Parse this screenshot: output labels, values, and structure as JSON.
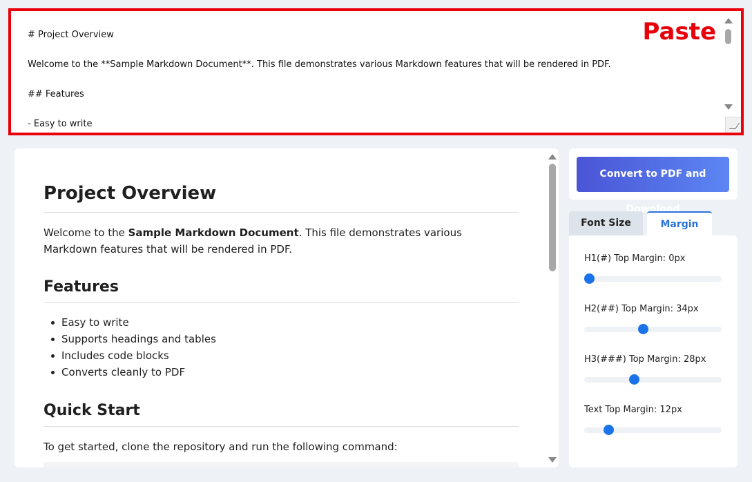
{
  "editor": {
    "lines": [
      "# Project Overview",
      "Welcome to the **Sample Markdown Document**. This file demonstrates various Markdown features that will be rendered in PDF.",
      "## Features",
      "- Easy to write"
    ],
    "annotation": "Paste"
  },
  "preview": {
    "h1": "Project Overview",
    "intro_before": "Welcome to the ",
    "intro_bold": "Sample Markdown Document",
    "intro_after": ". This file demonstrates various Markdown features that will be rendered in PDF.",
    "features_heading": "Features",
    "features": [
      "Easy to write",
      "Supports headings and tables",
      "Includes code blocks",
      "Converts cleanly to PDF"
    ],
    "quickstart_heading": "Quick Start",
    "quickstart_text": "To get started, clone the repository and run the following command:"
  },
  "sidebar": {
    "convert_label": "Convert to PDF and Download",
    "tabs": [
      {
        "label": "Font Size",
        "active": false
      },
      {
        "label": "Margin",
        "active": true
      }
    ],
    "settings": [
      {
        "label": "H1(#) Top Margin: 0px",
        "value": 0
      },
      {
        "label": "H2(##) Top Margin: 34px",
        "value": 34
      },
      {
        "label": "H3(###) Top Margin: 28px",
        "value": 28
      },
      {
        "label": "Text Top Margin: 12px",
        "value": 12
      }
    ]
  },
  "colors": {
    "annotation": "#e8000b",
    "accent": "#2a73d8",
    "slider": "#1a73e8"
  }
}
